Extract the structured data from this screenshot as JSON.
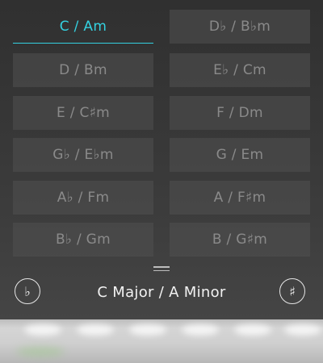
{
  "key_picker": {
    "keys": [
      {
        "label": "C / Am",
        "selected": true
      },
      {
        "label": "D♭ / B♭m",
        "selected": false
      },
      {
        "label": "D / Bm",
        "selected": false
      },
      {
        "label": "E♭ / Cm",
        "selected": false
      },
      {
        "label": "E / C♯m",
        "selected": false
      },
      {
        "label": "F / Dm",
        "selected": false
      },
      {
        "label": "G♭ / E♭m",
        "selected": false
      },
      {
        "label": "G / Em",
        "selected": false
      },
      {
        "label": "A♭ / Fm",
        "selected": false
      },
      {
        "label": "A / F♯m",
        "selected": false
      },
      {
        "label": "B♭ / Gm",
        "selected": false
      },
      {
        "label": "B / G♯m",
        "selected": false
      }
    ],
    "accent_color": "#34d1e0"
  },
  "footer": {
    "flat_symbol": "♭",
    "sharp_symbol": "♯",
    "current_key": "C Major / A Minor",
    "flat_icon": "flat-icon",
    "sharp_icon": "sharp-icon",
    "handle_icon": "drag-handle-icon"
  }
}
